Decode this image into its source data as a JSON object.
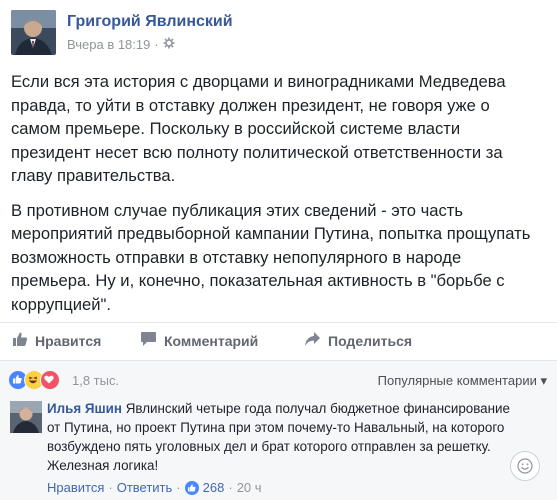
{
  "post": {
    "author": "Григорий Явлинский",
    "time": "Вчера в 18:19",
    "separator": "·",
    "paragraphs": [
      "Если вся эта история с дворцами и виноградниками Медведева правда, то уйти в отставку должен президент, не говоря уже о самом премьере. Поскольку в российской системе власти президент несет всю полноту политической ответственности за главу правительства.",
      "В противном случае публикация этих сведений - это часть мероприятий предвыборной кампании Путина, попытка прощупать возможность отправки в отставку непопулярного в народе премьера. Ну и, конечно, показательная активность в \"борьбе с коррупцией\"."
    ]
  },
  "actions": {
    "like": "Нравится",
    "comment": "Комментарий",
    "share": "Поделиться"
  },
  "reactions": {
    "count": "1,8 тыс.",
    "sort_label": "Популярные комментарии",
    "sort_arrow": "▾",
    "icons": [
      "like-icon",
      "haha-icon",
      "love-icon"
    ]
  },
  "comment": {
    "author": "Илья Яшин",
    "text": " Явлинский четыре года получал бюджетное финансирование от Путина, но проект Путина при этом почему-то Навальный, на которого возбуждено пять уголовных дел и брат которого отправлен за решетку. Железная логика!",
    "like": "Нравится",
    "reply": "Ответить",
    "likes": "268",
    "age": "20 ч",
    "dot": "·"
  },
  "colors": {
    "link": "#365899",
    "secondary": "#90949c",
    "like_blue": "#4a86ff",
    "love_red": "#f25268",
    "haha_yellow": "#fcd142"
  }
}
